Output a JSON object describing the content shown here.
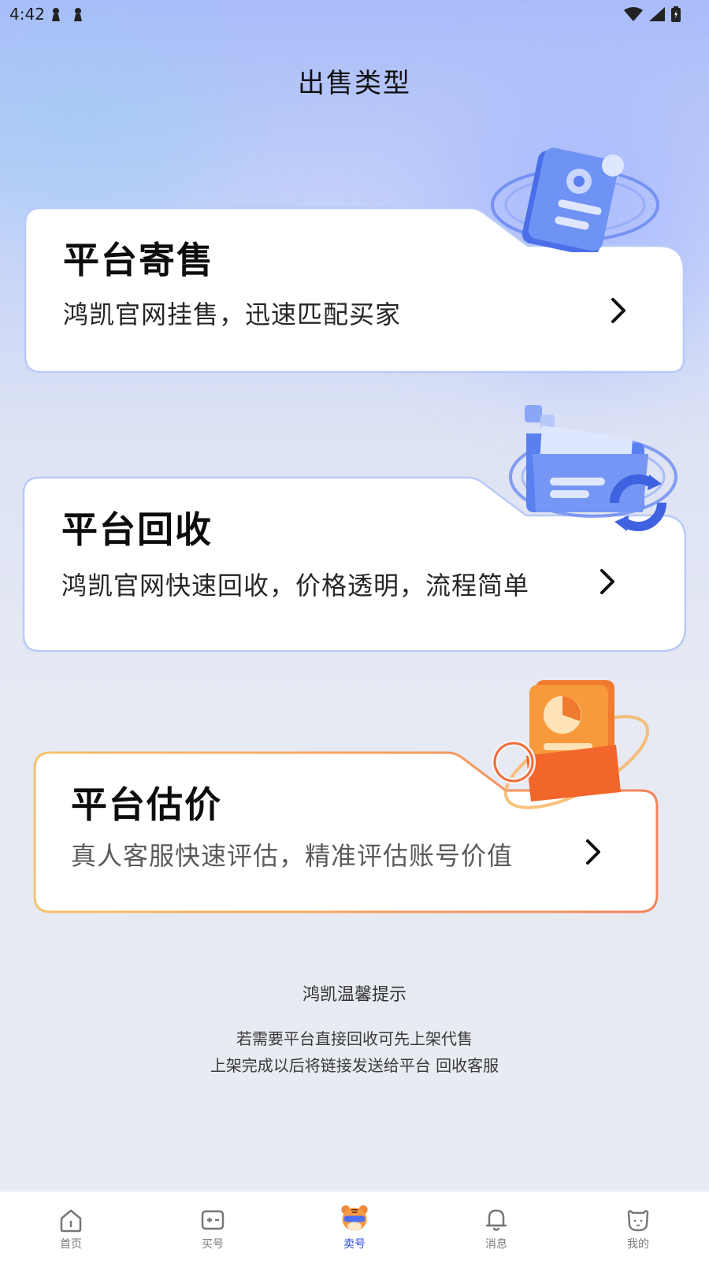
{
  "status_bar": {
    "time": "4:42"
  },
  "page": {
    "title": "出售类型"
  },
  "cards": [
    {
      "title": "平台寄售",
      "description": "鸿凯官网挂售，迅速匹配买家",
      "illustration": "document-icon",
      "accent": "#7a9bf5"
    },
    {
      "title": "平台回收",
      "description": "鸿凯官网快速回收，价格透明，流程简单",
      "illustration": "folder-recycle-icon",
      "accent": "#7a9bf5"
    },
    {
      "title": "平台估价",
      "description": "真人客服快速评估，精准评估账号价值",
      "illustration": "valuation-chart-icon",
      "accent": "#f5a04a"
    }
  ],
  "tips": {
    "title": "鸿凯温馨提示",
    "lines": [
      "若需要平台直接回收可先上架代售",
      "上架完成以后将链接发送给平台 回收客服"
    ]
  },
  "bottom_nav": {
    "active_color": "#2c4be6",
    "items": [
      {
        "label": "首页",
        "icon": "home-icon"
      },
      {
        "label": "买号",
        "icon": "buy-icon"
      },
      {
        "label": "卖号",
        "icon": "tiger-mascot-icon",
        "active": true
      },
      {
        "label": "消息",
        "icon": "bell-icon"
      },
      {
        "label": "我的",
        "icon": "profile-bear-icon"
      }
    ]
  }
}
